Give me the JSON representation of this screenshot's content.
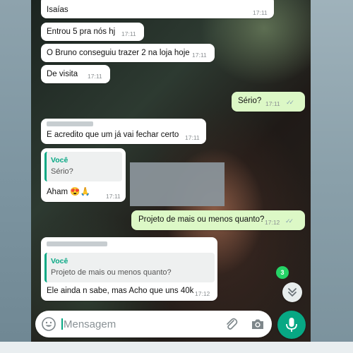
{
  "messages": [
    {
      "text": "Isaías",
      "time": "17:11"
    },
    {
      "text": "Entrou 5 pra nós hj",
      "time": "17:11"
    },
    {
      "text": "O Bruno conseguiu trazer 2 na loja hoje",
      "time": "17:11"
    },
    {
      "text": "De visita",
      "time": "17:11"
    },
    {
      "text": "Sério?",
      "time": "17:11"
    },
    {
      "text": "E acredito que um já vai fechar certo",
      "time": "17:11"
    },
    {
      "quote_name": "Você",
      "quote_text": "Sério?",
      "text": "Aham 😍🙏",
      "time": "17:11"
    },
    {
      "text": "Projeto de mais ou menos quanto?",
      "time": "17:12"
    },
    {
      "quote_name": "Você",
      "quote_text": "Projeto de mais ou menos quanto?",
      "text": "Ele ainda n sabe, mas Acho que uns 40k",
      "time": "17:12"
    }
  ],
  "unread_badge": "3",
  "composer": {
    "placeholder": "Mensagem"
  },
  "icons": {
    "emoji": "emoji-icon",
    "attach": "paperclip-icon",
    "camera": "camera-icon",
    "mic": "microphone-icon",
    "scroll": "double-chevron-down-icon",
    "read_receipt": "double-check-icon"
  },
  "colors": {
    "incoming_bubble": "#ffffff",
    "outgoing_bubble": "#dcf8c6",
    "accent": "#07a884",
    "badge": "#25d366"
  }
}
